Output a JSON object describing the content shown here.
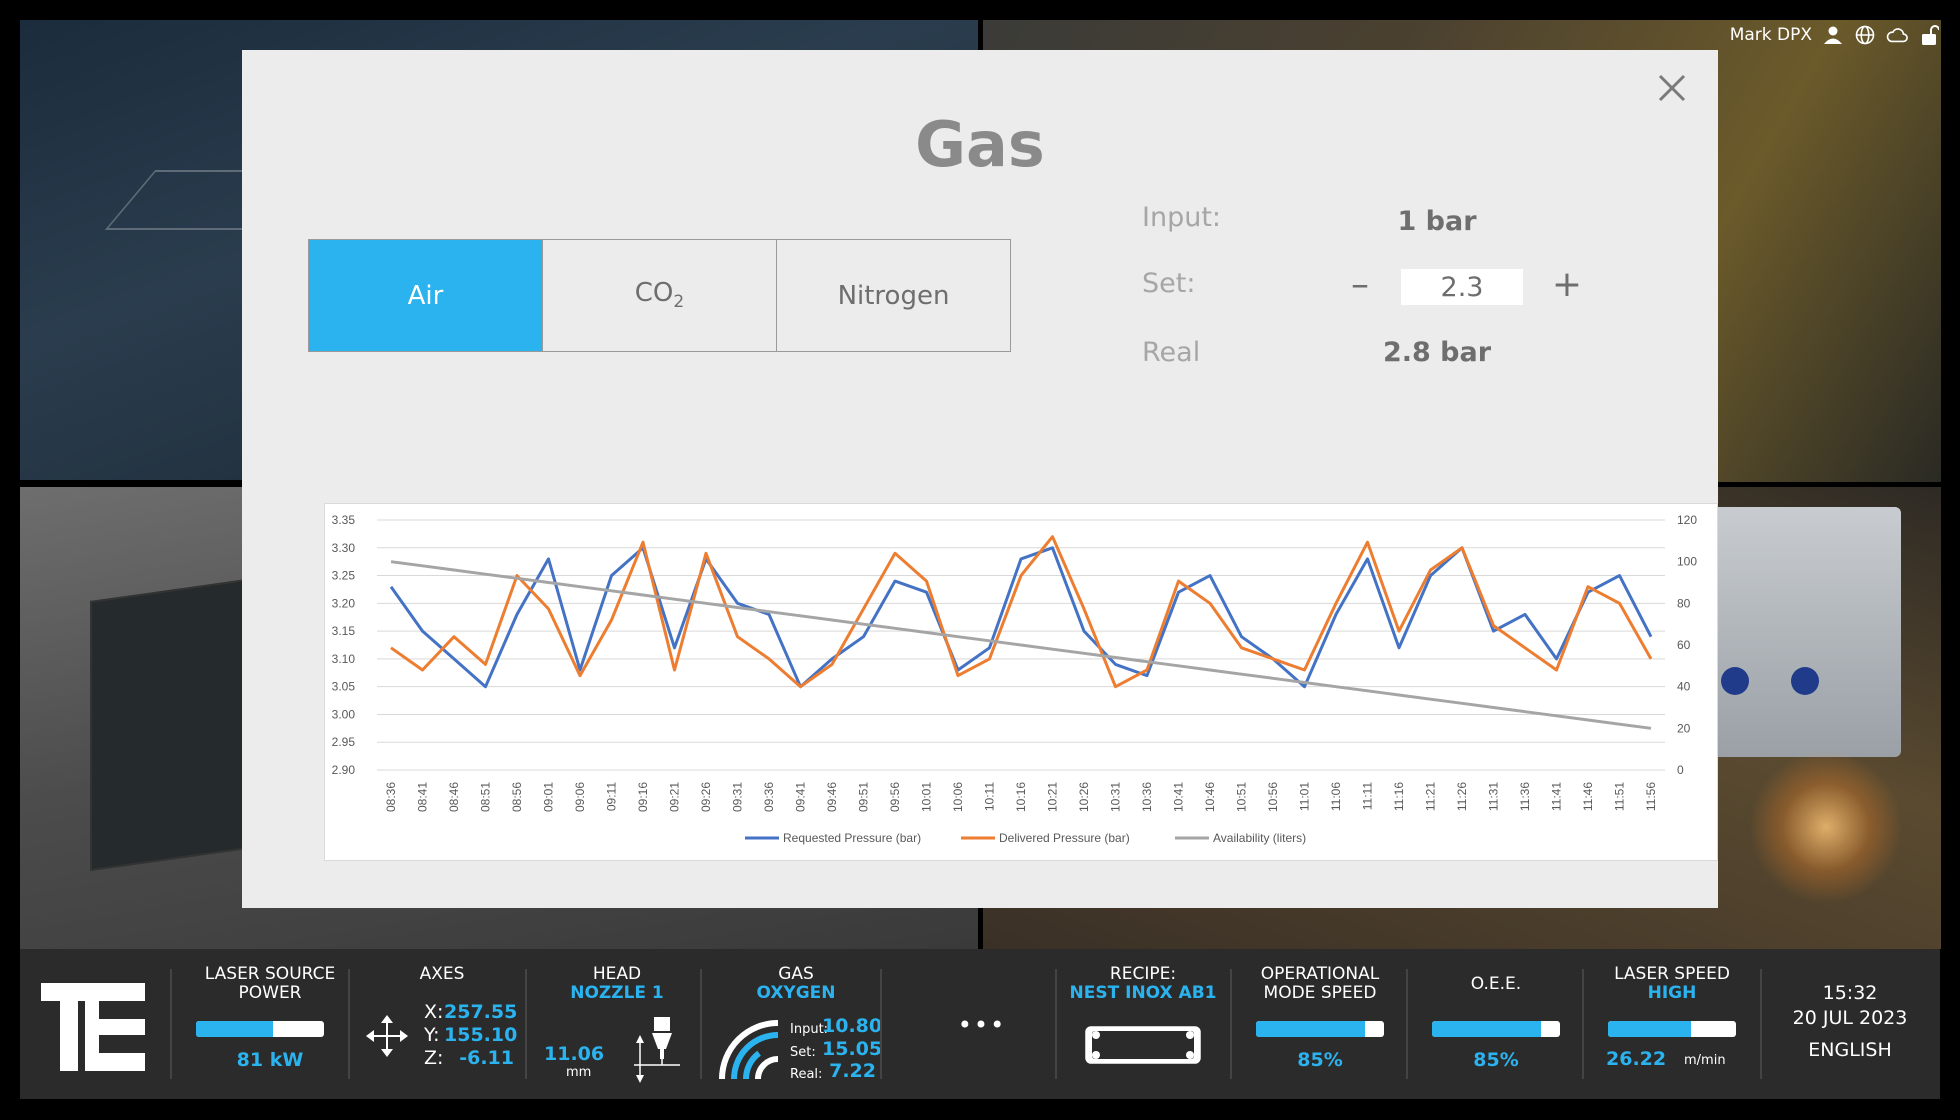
{
  "user": {
    "name": "Mark DPX"
  },
  "modal": {
    "title": "Gas",
    "gas_types": [
      {
        "label": "Air",
        "active": true
      },
      {
        "label": "CO",
        "sub": "2",
        "active": false
      },
      {
        "label": "Nitrogen",
        "active": false
      }
    ],
    "input_label": "Input:",
    "input_value": "1 bar",
    "set_label": "Set:",
    "set_value": "2.3",
    "real_label": "Real",
    "real_value": "2.8 bar"
  },
  "chart_data": {
    "type": "line",
    "x": [
      "08:36",
      "08:41",
      "08:46",
      "08:51",
      "08:56",
      "09:01",
      "09:06",
      "09:11",
      "09:16",
      "09:21",
      "09:26",
      "09:31",
      "09:36",
      "09:41",
      "09:46",
      "09:51",
      "09:56",
      "10:01",
      "10:06",
      "10:11",
      "10:16",
      "10:21",
      "10:26",
      "10:31",
      "10:36",
      "10:41",
      "10:46",
      "10:51",
      "10:56",
      "11:01",
      "11:06",
      "11:11",
      "11:16",
      "11:21",
      "11:26",
      "11:31",
      "11:36",
      "11:41",
      "11:46",
      "11:51",
      "11:56"
    ],
    "series": [
      {
        "name": "Requested Pressure (bar)",
        "axis": "left",
        "color": "#4472c4",
        "values": [
          3.23,
          3.15,
          3.1,
          3.05,
          3.18,
          3.28,
          3.08,
          3.25,
          3.3,
          3.12,
          3.28,
          3.2,
          3.18,
          3.05,
          3.1,
          3.14,
          3.24,
          3.22,
          3.08,
          3.12,
          3.28,
          3.3,
          3.15,
          3.09,
          3.07,
          3.22,
          3.25,
          3.14,
          3.1,
          3.05,
          3.18,
          3.28,
          3.12,
          3.25,
          3.3,
          3.15,
          3.18,
          3.1,
          3.22,
          3.25,
          3.14
        ]
      },
      {
        "name": "Delivered Pressure (bar)",
        "axis": "left",
        "color": "#ed7d31",
        "values": [
          3.12,
          3.08,
          3.14,
          3.09,
          3.25,
          3.19,
          3.07,
          3.17,
          3.31,
          3.08,
          3.29,
          3.14,
          3.1,
          3.05,
          3.09,
          3.19,
          3.29,
          3.24,
          3.07,
          3.1,
          3.25,
          3.32,
          3.19,
          3.05,
          3.08,
          3.24,
          3.2,
          3.12,
          3.1,
          3.08,
          3.2,
          3.31,
          3.15,
          3.26,
          3.3,
          3.16,
          3.12,
          3.08,
          3.23,
          3.2,
          3.1
        ]
      },
      {
        "name": "Availability (liters)",
        "axis": "right",
        "color": "#a5a5a5",
        "values": [
          100,
          98,
          96,
          94,
          92,
          90,
          88,
          86,
          84,
          82,
          80,
          78,
          76,
          74,
          72,
          70,
          68,
          66,
          64,
          62,
          60,
          58,
          56,
          54,
          52,
          50,
          48,
          46,
          44,
          42,
          40,
          38,
          36,
          34,
          32,
          30,
          28,
          26,
          24,
          22,
          20
        ]
      }
    ],
    "y_left": {
      "ticks": [
        "2.90",
        "2.95",
        "3.00",
        "3.05",
        "3.10",
        "3.15",
        "3.20",
        "3.25",
        "3.30",
        "3.35"
      ],
      "min": 2.9,
      "max": 3.35
    },
    "y_right": {
      "ticks": [
        "0",
        "20",
        "40",
        "60",
        "80",
        "100",
        "120"
      ],
      "min": 0,
      "max": 120
    },
    "grid": true,
    "legend": "bottom"
  },
  "status": {
    "laser_source": {
      "title_1": "LASER SOURCE",
      "title_2": "POWER",
      "value": "81 kW",
      "level": 0.6
    },
    "axes": {
      "title": "AXES",
      "x_label": "X:",
      "x": "257.55",
      "y_label": "Y:",
      "y": "155.10",
      "z_label": "Z:",
      "z": "-6.11"
    },
    "head": {
      "title": "HEAD",
      "sub": "NOZZLE 1",
      "value": "11.06",
      "unit": "mm"
    },
    "gas": {
      "title": "GAS",
      "sub": "OXYGEN",
      "input_label": "Input:",
      "input": "10.80",
      "set_label": "Set:",
      "set": "15.05",
      "real_label": "Real:",
      "real": "7.22"
    },
    "more": "•••",
    "recipe": {
      "title": "RECIPE:",
      "sub": "NEST INOX AB1"
    },
    "op_speed": {
      "title_1": "OPERATIONAL",
      "title_2": "MODE SPEED",
      "value": "85%",
      "level": 0.85
    },
    "oee": {
      "title": "O.E.E.",
      "value": "85%",
      "level": 0.85
    },
    "laser_speed": {
      "title": "LASER SPEED",
      "sub": "HIGH",
      "value": "26.22",
      "unit": "m/min",
      "level": 0.65
    },
    "clock": {
      "time": "15:32",
      "date": "20 JUL 2023",
      "language": "ENGLISH"
    }
  },
  "colors": {
    "accent": "#2bb3ef",
    "bar_bg": "#2b2b2b",
    "modal_bg": "#ececec"
  }
}
